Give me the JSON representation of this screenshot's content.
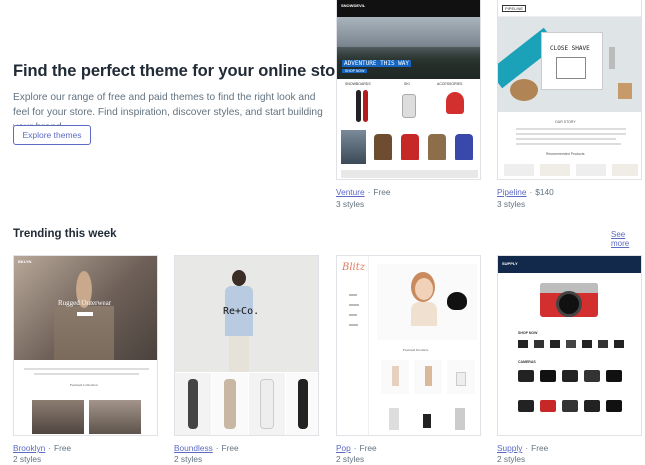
{
  "hero": {
    "title": "Find the perfect theme for your online store",
    "description": "Explore our range of free and paid themes to find the right look and feel for your store. Find inspiration, discover styles, and start building your brand.",
    "button_label": "Explore themes"
  },
  "featured": [
    {
      "name": "Venture",
      "price": "Free",
      "styles": "3 styles",
      "preview": {
        "brand": "SNOWDEVIL",
        "banner": "ADVENTURE THIS WAY",
        "banner_btn": "SHOP NOW",
        "categories": [
          "SNOWBOARDS",
          "SKI",
          "ACCESSORIES"
        ]
      }
    },
    {
      "name": "Pipeline",
      "price": "$140",
      "styles": "3 styles",
      "preview": {
        "brand": "PIPELINE",
        "banner": "CLOSE SHAVE",
        "section": "OUR STORY",
        "section2": "Recommended Products"
      }
    }
  ],
  "trending": {
    "title": "Trending this week",
    "see_more": "See more",
    "themes": [
      {
        "name": "Brooklyn",
        "price": "Free",
        "styles": "2 styles",
        "preview": {
          "brand": "BKLYN",
          "banner": "Rugged Outerwear",
          "section": "Featured Collection"
        }
      },
      {
        "name": "Boundless",
        "price": "Free",
        "styles": "2 styles",
        "preview": {
          "banner": "Re+Co."
        }
      },
      {
        "name": "Pop",
        "price": "Free",
        "styles": "2 styles",
        "preview": {
          "brand": "Blitz",
          "section": "Featured Products"
        }
      },
      {
        "name": "Supply",
        "price": "Free",
        "styles": "2 styles",
        "preview": {
          "brand": "SUPPLY",
          "section": "SHOP NOW",
          "section2": "CAMERAS"
        }
      }
    ]
  },
  "separator": "·",
  "colors": {
    "accent": "#5c6ac4",
    "text": "#212b36",
    "muted": "#637381"
  }
}
